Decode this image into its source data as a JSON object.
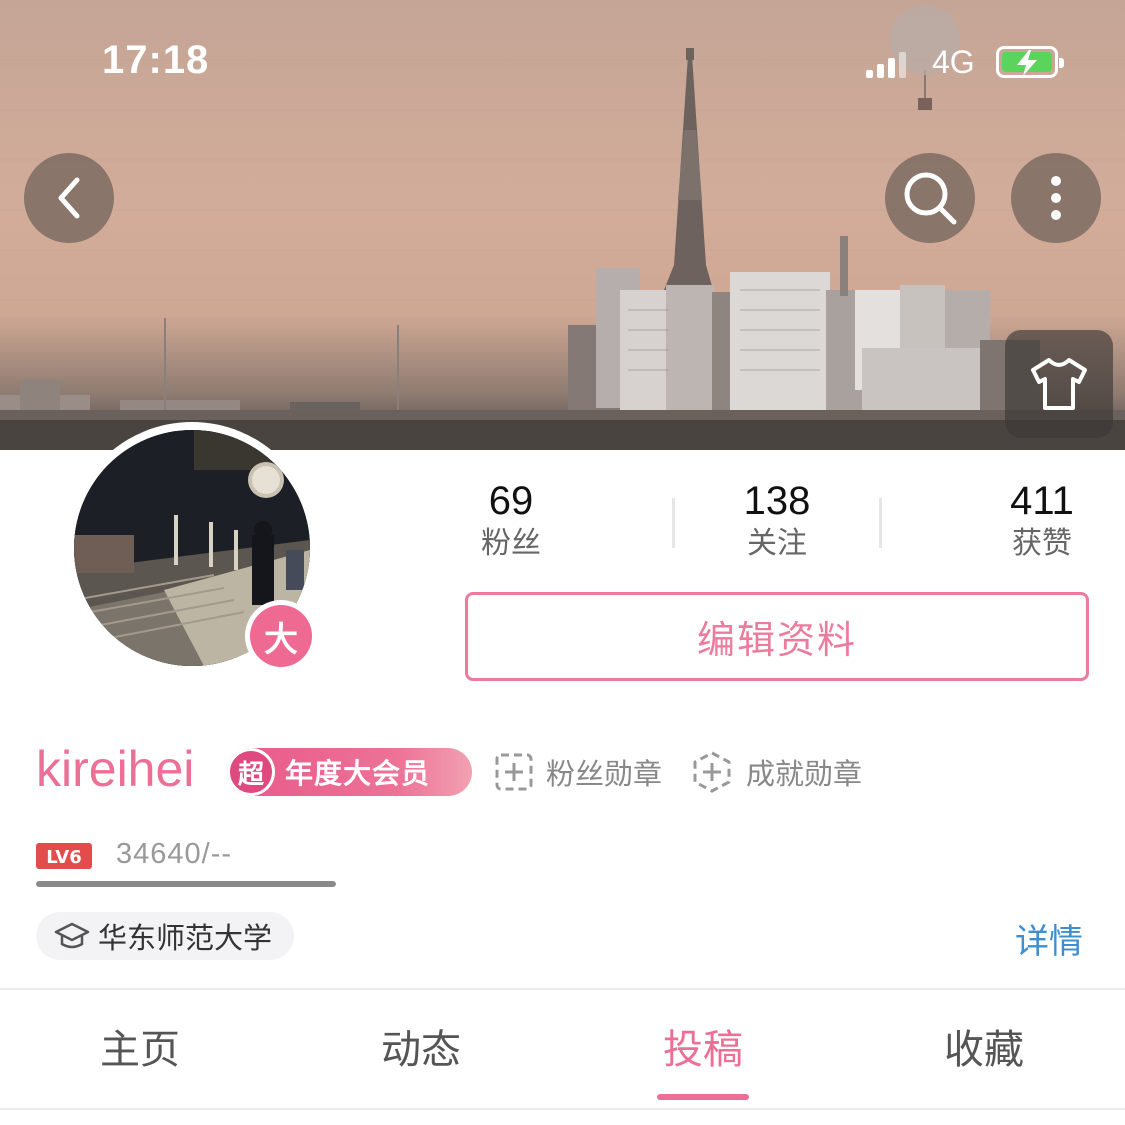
{
  "status_bar": {
    "time": "17:18",
    "network": "4G",
    "battery_state": "charging"
  },
  "header": {
    "back_icon": "chevron-left-icon",
    "search_icon": "search-icon",
    "more_icon": "more-vertical-icon",
    "dress_icon": "tshirt-icon"
  },
  "profile": {
    "avatar_badge": "大",
    "username": "kireihei",
    "vip": {
      "badge_char": "超",
      "label": "年度大会员"
    },
    "medals": [
      {
        "label": "粉丝勋章",
        "icon": "plus-box-icon"
      },
      {
        "label": "成就勋章",
        "icon": "plus-hexagon-icon"
      }
    ],
    "level": {
      "tag": "LV6",
      "exp_text": "34640/--",
      "progress": 1.0
    },
    "school": "华东师范大学",
    "details_label": "详情",
    "edit_label": "编辑资料"
  },
  "stats": {
    "fans": {
      "value": "69",
      "label": "粉丝"
    },
    "following": {
      "value": "138",
      "label": "关注"
    },
    "likes": {
      "value": "411",
      "label": "获赞"
    }
  },
  "tabs": [
    {
      "label": "主页",
      "active": false
    },
    {
      "label": "动态",
      "active": false
    },
    {
      "label": "投稿",
      "active": true
    },
    {
      "label": "收藏",
      "active": false
    }
  ],
  "colors": {
    "accent": "#ec6f96",
    "link": "#3f8fd0",
    "vip_badge": "#e8588a"
  }
}
